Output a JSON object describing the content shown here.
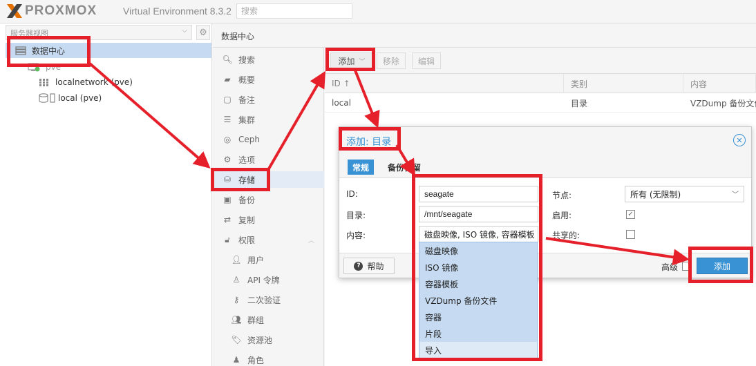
{
  "app": {
    "brand": "PROXMOX",
    "version": "Virtual Environment 8.3.2",
    "search_placeholder": "搜索",
    "accent": "#3892d4",
    "annotation_color": "#e5202a"
  },
  "tree": {
    "view_select": "服务器视图",
    "items": [
      {
        "label": "数据中心",
        "icon": "datacenter-icon"
      },
      {
        "label": "pve",
        "icon": "node-icon"
      },
      {
        "label": "localnetwork (pve)",
        "icon": "network-grid-icon"
      },
      {
        "label": "local (pve)",
        "icon": "storage-icon"
      }
    ]
  },
  "content_header": "数据中心",
  "nav": {
    "items": [
      {
        "label": "搜索",
        "icon": "search-icon"
      },
      {
        "label": "概要",
        "icon": "book-icon"
      },
      {
        "label": "备注",
        "icon": "note-icon"
      },
      {
        "label": "集群",
        "icon": "cluster-icon"
      },
      {
        "label": "Ceph",
        "icon": "ceph-icon"
      },
      {
        "label": "选项",
        "icon": "gear-icon"
      },
      {
        "label": "存储",
        "icon": "database-icon"
      },
      {
        "label": "备份",
        "icon": "floppy-icon"
      },
      {
        "label": "复制",
        "icon": "retweet-icon"
      },
      {
        "label": "权限",
        "icon": "unlock-icon"
      },
      {
        "label": "用户",
        "icon": "user-icon"
      },
      {
        "label": "API 令牌",
        "icon": "user-outline-icon"
      },
      {
        "label": "二次验证",
        "icon": "key-icon"
      },
      {
        "label": "群组",
        "icon": "users-icon"
      },
      {
        "label": "资源池",
        "icon": "tags-icon"
      },
      {
        "label": "角色",
        "icon": "male-icon"
      }
    ]
  },
  "toolbar": {
    "add": "添加",
    "remove": "移除",
    "edit": "编辑"
  },
  "grid": {
    "columns": [
      "ID",
      "类别",
      "内容"
    ],
    "rows": [
      [
        "local",
        "目录",
        "VZDump 备份文件"
      ]
    ]
  },
  "dialog": {
    "title": "添加: 目录",
    "tabs": [
      "常规",
      "备份保留"
    ],
    "fields": {
      "id_label": "ID:",
      "id_value": "seagate",
      "dir_label": "目录:",
      "dir_value": "/mnt/seagate",
      "content_label": "内容:",
      "content_value": "磁盘映像, ISO 镜像, 容器模板",
      "node_label": "节点:",
      "node_value": "所有 (无限制)",
      "enable_label": "启用:",
      "enable_checked": true,
      "shared_label": "共享的:",
      "shared_checked": false
    },
    "help": "帮助",
    "advanced": "高级",
    "add": "添加"
  },
  "content_options": [
    "磁盘映像",
    "ISO 镜像",
    "容器模板",
    "VZDump 备份文件",
    "容器",
    "片段",
    "导入"
  ]
}
